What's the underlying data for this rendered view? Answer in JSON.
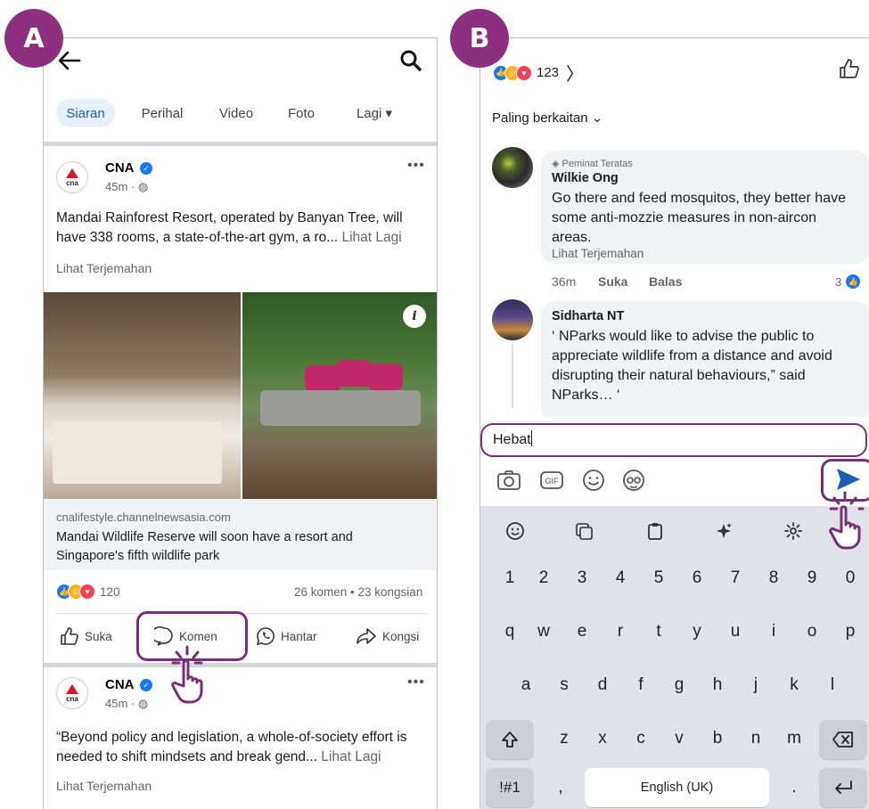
{
  "badges": {
    "a": "A",
    "b": "B"
  },
  "screenA": {
    "tabs": [
      {
        "label": "Siaran",
        "active": true
      },
      {
        "label": "Perihal",
        "active": false
      },
      {
        "label": "Video",
        "active": false
      },
      {
        "label": "Foto",
        "active": false
      },
      {
        "label": "Lagi ▾",
        "active": false
      }
    ],
    "logo_text": "cna",
    "post1": {
      "author": "CNA",
      "time": "45m · ",
      "text": "Mandai Rainforest Resort, operated by Banyan Tree, will have 338 rooms, a state-of-the-art gym, a ro... ",
      "see_more": "Lihat Lagi",
      "see_translation": "Lihat Terjemahan",
      "link_domain": "cnalifestyle.channelnewsasia.com",
      "link_title": "Mandai Wildlife Reserve will soon have a resort and Singapore's fifth wildlife park",
      "reaction_count": "120",
      "stats": "26 komen • 23 kongsian"
    },
    "actions": {
      "like": "Suka",
      "comment": "Komen",
      "send": "Hantar",
      "share": "Kongsi"
    },
    "post2": {
      "author": "CNA",
      "time": "45m · ",
      "text": "“Beyond policy and legislation, a whole-of-society effort is needed to shift mindsets and break gend... ",
      "see_more": "Lihat Lagi",
      "see_translation": "Lihat Terjemahan"
    }
  },
  "screenB": {
    "reaction_count": "123",
    "sort_label": "Paling berkaitan",
    "comments": [
      {
        "badge": "Peminat Teratas",
        "name": "Wilkie Ong",
        "text": "Go there and feed mosquitos, they better have some anti-mozzie measures in non-aircon areas.",
        "translate": "Lihat Terjemahan",
        "time": "36m",
        "like": "Suka",
        "reply": "Balas",
        "likes": "3"
      },
      {
        "name": "Sidharta NT",
        "text": "‘ NParks would like to advise the public to appreciate wildlife from a distance and avoid disrupting their natural behaviours,” said NParks… ‘"
      }
    ],
    "input_value": "Hebat",
    "keyboard": {
      "numbers": [
        "1",
        "2",
        "3",
        "4",
        "5",
        "6",
        "7",
        "8",
        "9",
        "0"
      ],
      "row1": [
        "q",
        "w",
        "e",
        "r",
        "t",
        "y",
        "u",
        "i",
        "o",
        "p"
      ],
      "row2": [
        "a",
        "s",
        "d",
        "f",
        "g",
        "h",
        "j",
        "k",
        "l"
      ],
      "row3": [
        "z",
        "x",
        "c",
        "v",
        "b",
        "n",
        "m"
      ],
      "symbols": "!#1",
      "comma": ",",
      "space": "English (UK)",
      "period": "."
    }
  },
  "colors": {
    "accent": "#7a2f78",
    "badge": "#8e2f82",
    "fb_blue": "#1877f2"
  }
}
